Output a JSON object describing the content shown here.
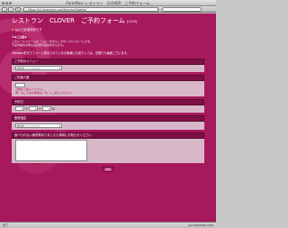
{
  "window": {
    "title": "FormMan: レストラン　CLOVER　ご予約フォーム"
  },
  "toolbar": {
    "url": "https://ssl.formman.com/form/ssl/ijzarbz/"
  },
  "page": {
    "title": "レストラン　CLOVER　ご予約フォーム",
    "title_suffix": "[CLVS]",
    "required_note": "は入力必須項目です",
    "required_mark": "※",
    "intro_heading": "＊◆ご注意◆",
    "intro_lines": [
      "このメールフォームは「ふぉーままん」のサンプルフォームです。",
      "下記内容のお申込はお受付出来ませんので。"
    ],
    "notice": "※Wizard形式でフォーム表示されているお客様にお送りしては、空欄でも画面ございます。"
  },
  "form": {
    "menu": {
      "label": "ご予約のメニュー",
      "placeholder": "▼選択してください"
    },
    "people": {
      "label": "ご利用人数",
      "hint1": "人数をご記入ください。",
      "hint2": "例）おこさまの場合は「2」とご記入ください。"
    },
    "time": {
      "label": "予約日",
      "sep1": "月",
      "sep2": "日",
      "sep3": "時"
    },
    "seat": {
      "label": "座席指定",
      "placeholder": "▼選択してください"
    },
    "comments": {
      "label": "食べられない食材等ありましたら事前にお知らせください"
    },
    "submit_label": "送信"
  },
  "status": {
    "left": "完了",
    "right": "ssl.formman.com"
  },
  "colors": {
    "background": "#a8185c",
    "section_header": "#7d1045",
    "section_body": "#d8b8c8",
    "required": "#ffd54a"
  },
  "icons": [
    "back-arrow-icon",
    "forward-arrow-icon",
    "reload-icon",
    "lock-icon",
    "dropdown-arrow-icon"
  ]
}
